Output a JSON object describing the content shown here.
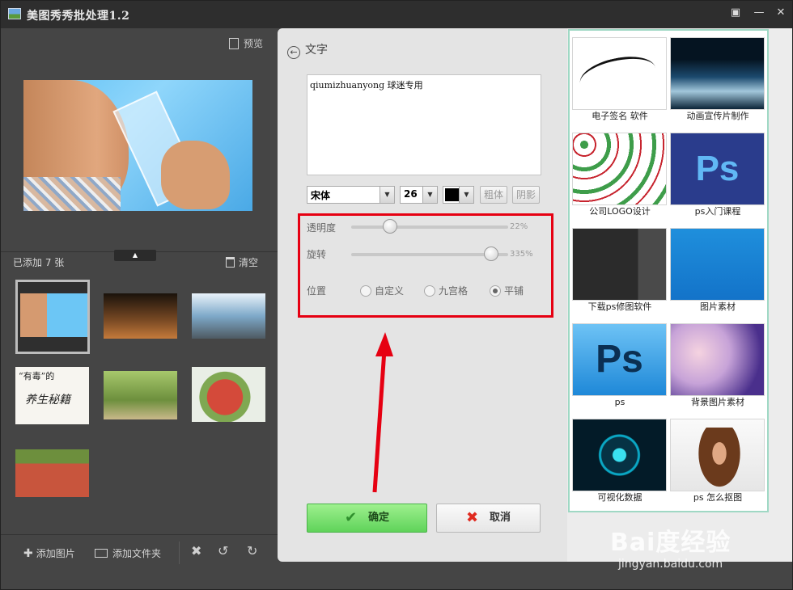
{
  "window": {
    "title": "美图秀秀批处理1.2",
    "controls": [
      "chat-icon",
      "minimize-icon",
      "close-icon"
    ]
  },
  "left_panel": {
    "preview_label": "预览",
    "added_label": "已添加 7 张",
    "clear_label": "清空",
    "thumb_text_line1": "“有毒”的",
    "thumb_text_line2": "养生秘籍",
    "bottom": {
      "add_image": "添加图片",
      "add_folder": "添加文件夹"
    }
  },
  "text_panel": {
    "title": "文字",
    "text_value": "qiumizhuanyong 球迷专用",
    "font": "宋体",
    "size": "26",
    "bold_label": "粗体",
    "shadow_label": "阴影",
    "opacity_label": "透明度",
    "opacity_value": "22%",
    "opacity_fraction": 0.22,
    "rotate_label": "旋转",
    "rotate_value": "335%",
    "position_label": "位置",
    "position_options": [
      "自定义",
      "九宫格",
      "平铺"
    ],
    "position_selected": "平铺",
    "ok_label": "确定",
    "cancel_label": "取消"
  },
  "ads": [
    {
      "caption": "电子签名 软件",
      "icon": "signature-image"
    },
    {
      "caption": "动画宣传片制作",
      "icon": "eagle-landscape-image"
    },
    {
      "caption": "公司LOGO设计",
      "icon": "logo-grid-image"
    },
    {
      "caption": "ps入门课程",
      "icon": "ps-logo-image",
      "pic_text": "Ps"
    },
    {
      "caption": "下载ps修图软件",
      "icon": "ps-screenshot-image"
    },
    {
      "caption": "图片素材",
      "icon": "blue-texture-image"
    },
    {
      "caption": "ps",
      "icon": "ps-logo-image",
      "pic_text": "Ps"
    },
    {
      "caption": "背景图片素材",
      "icon": "bokeh-image"
    },
    {
      "caption": "可视化数据",
      "icon": "hud-image"
    },
    {
      "caption": "ps 怎么抠图",
      "icon": "woman-hair-image"
    }
  ],
  "watermark": {
    "brand": "Bai度经验",
    "url": "jingyan.baidu.com"
  },
  "colors": {
    "highlight": "#e60012",
    "ok_button": "#5fd35a",
    "cancel_icon": "#e02a1f"
  }
}
